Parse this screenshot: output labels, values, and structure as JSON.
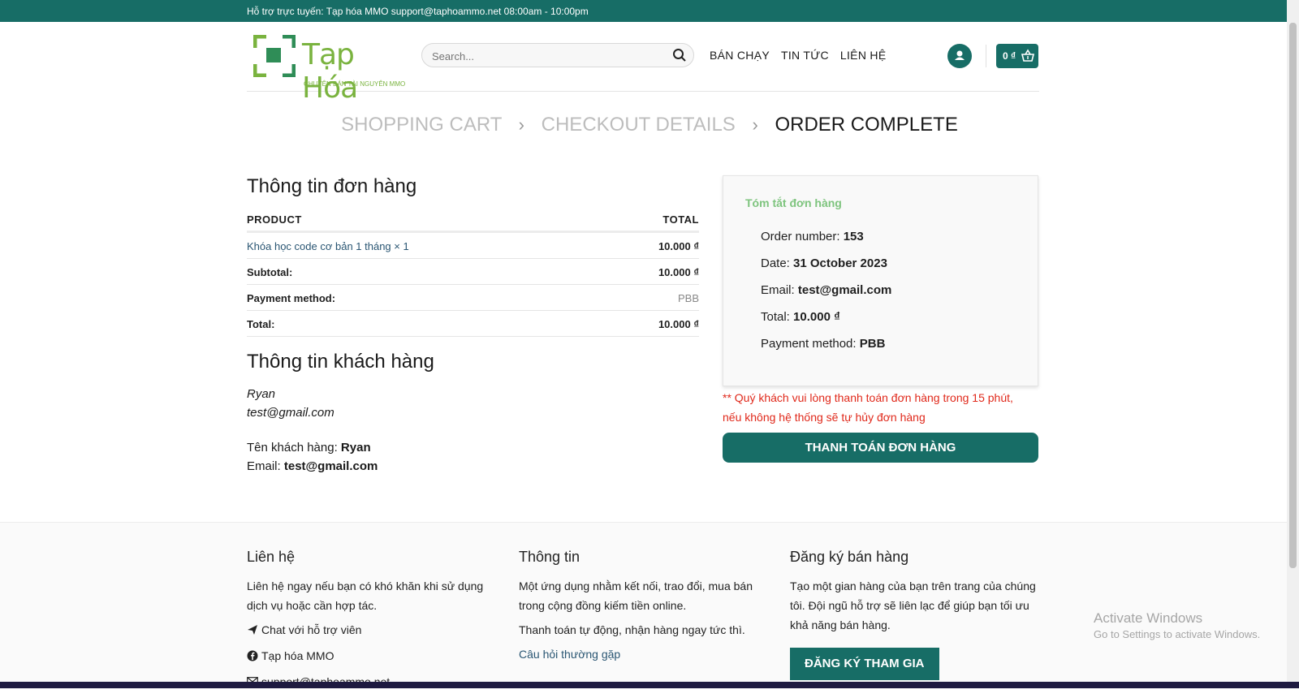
{
  "topbar": {
    "text": "Hỗ trợ trực tuyến: Tạp hóa MMO support@taphoammo.net 08:00am - 10:00pm"
  },
  "logo": {
    "title": "Tạp Hóa",
    "subtitle": "CHUYÊN BÁN TÀI NGUYÊN MMO"
  },
  "search": {
    "placeholder": "Search..."
  },
  "nav": {
    "items": [
      "BÁN CHẠY",
      "TIN TỨC",
      "LIÊN HỆ"
    ]
  },
  "cart": {
    "label": "0 ₫"
  },
  "steps": {
    "cart": "SHOPPING CART",
    "checkout": "CHECKOUT DETAILS",
    "complete": "ORDER COMPLETE"
  },
  "order": {
    "heading": "Thông tin đơn hàng",
    "col_product": "PRODUCT",
    "col_total": "TOTAL",
    "item_name": "Khóa học code cơ bản 1 tháng × 1",
    "item_total": "10.000 ₫",
    "subtotal_label": "Subtotal:",
    "subtotal_value": "10.000 ₫",
    "payment_label": "Payment method:",
    "payment_value": "PBB",
    "total_label": "Total:",
    "total_value": "10.000 ₫"
  },
  "customer": {
    "heading": "Thông tin khách hàng",
    "name": "Ryan",
    "email": "test@gmail.com",
    "name_label": "Tên khách hàng:",
    "name_value": "Ryan",
    "email_label": "Email:",
    "email_value": "test@gmail.com"
  },
  "summary": {
    "title": "Tóm tắt đơn hàng",
    "order_number_label": "Order number:",
    "order_number": "153",
    "date_label": "Date:",
    "date": "31 October 2023",
    "email_label": "Email:",
    "email": "test@gmail.com",
    "total_label": "Total:",
    "total": "10.000 ₫",
    "payment_label": "Payment method:",
    "payment": "PBB"
  },
  "warning": {
    "line1": "** Quý khách vui lòng thanh toán đơn hàng trong 15 phút,",
    "line2": "nếu không hệ thống sẽ tự hủy đơn hàng"
  },
  "pay_button": "THANH TOÁN ĐƠN HÀNG",
  "footer": {
    "contact": {
      "title": "Liên hệ",
      "desc": "Liên hệ ngay nếu bạn có khó khăn khi sử dụng dịch vụ hoặc cần hợp tác.",
      "chat": "Chat với hỗ trợ viên",
      "facebook": "Tạp hóa MMO",
      "email": "support@taphoammo.net"
    },
    "info": {
      "title": "Thông tin",
      "desc": "Một ứng dụng nhằm kết nối, trao đổi, mua bán trong cộng đồng kiếm tiền online.",
      "auto": "Thanh toán tự động, nhận hàng ngay tức thì.",
      "faq": "Câu hỏi thường gặp"
    },
    "register": {
      "title": "Đăng ký bán hàng",
      "desc": "Tạo một gian hàng của bạn trên trang của chúng tôi. Đội ngũ hỗ trợ sẽ liên lạc để giúp bạn tối ưu khả năng bán hàng.",
      "button": "ĐĂNG KÝ THAM GIA"
    }
  },
  "watermark": {
    "title": "Activate Windows",
    "sub": "Go to Settings to activate Windows."
  },
  "colors": {
    "brand": "#176d66",
    "logo_green": "#7ab33f",
    "warning": "#e0281a"
  }
}
